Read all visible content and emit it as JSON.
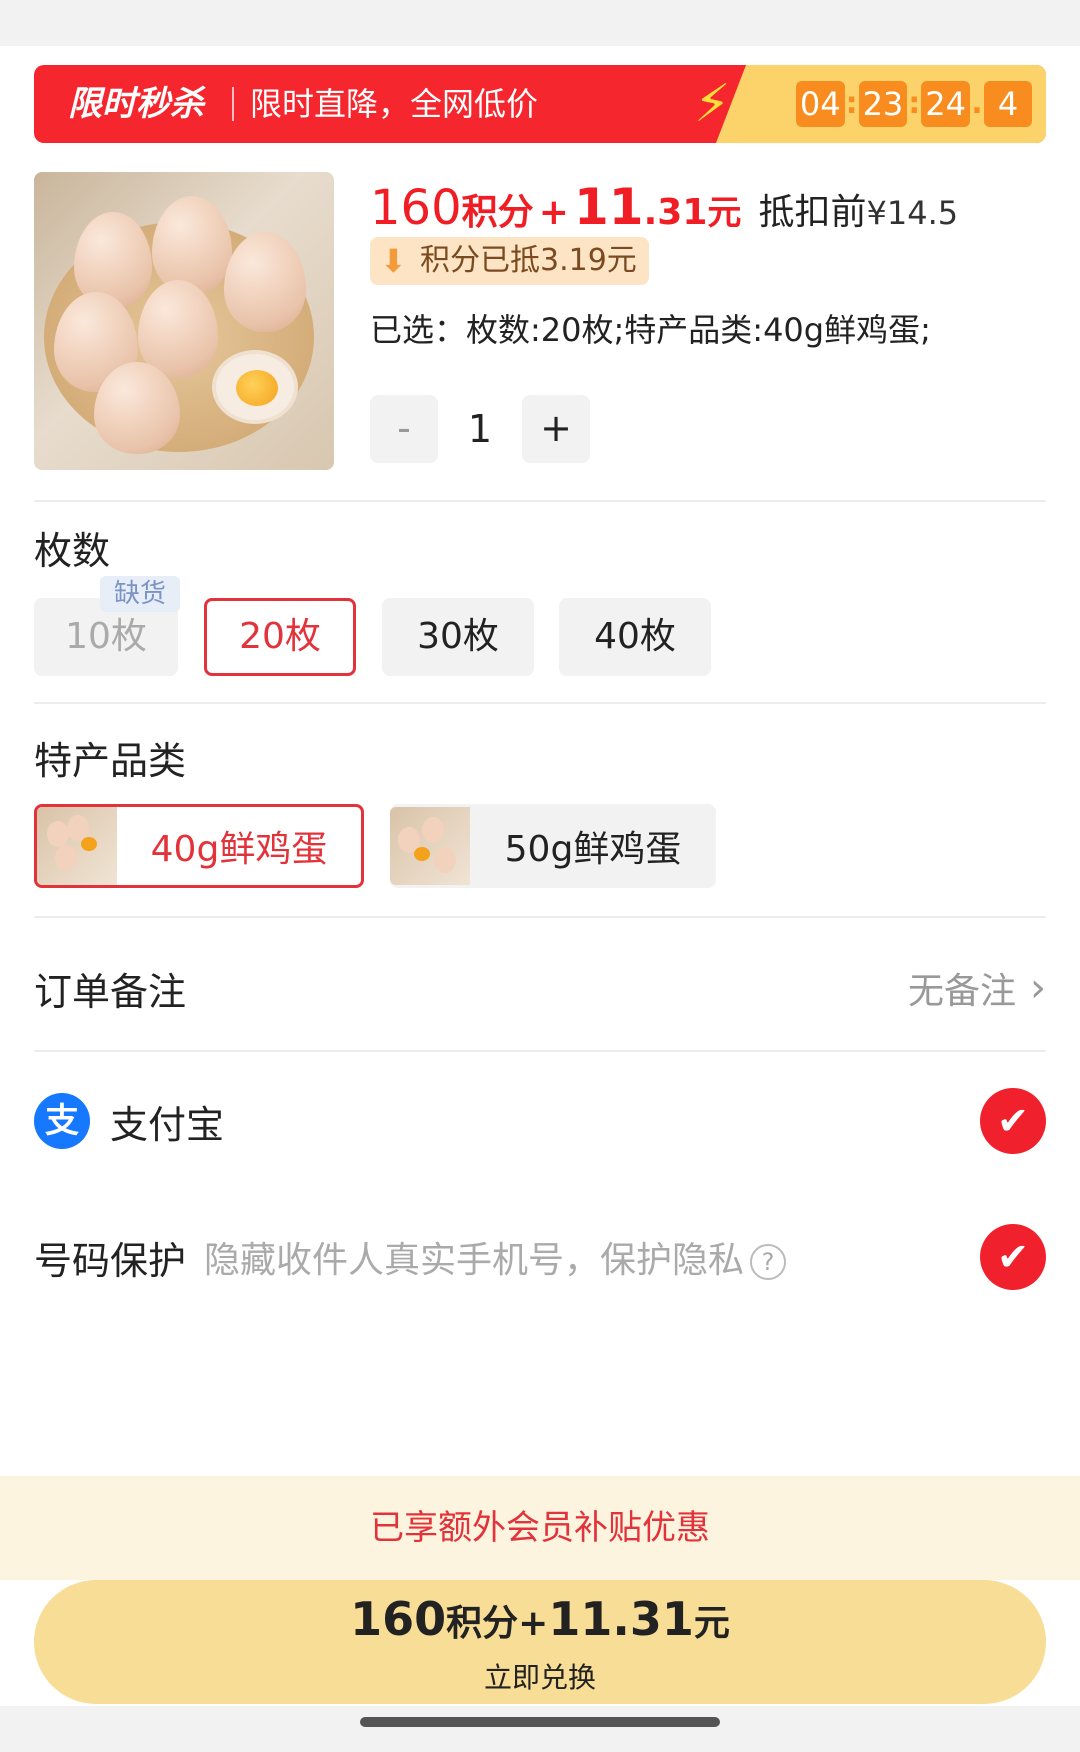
{
  "banner": {
    "tag": "限时秒杀",
    "slogan": "限时直降，全网低价",
    "timer": [
      "04",
      "23",
      "24",
      "4"
    ],
    "colors": {
      "bg": "#f5262d",
      "timer": "#f98c1e"
    }
  },
  "product": {
    "image_icon": "eggs-photo",
    "points": "160",
    "points_label": "积分",
    "plus": "+",
    "price_int": "11",
    "price_dec": ".31",
    "price_unit": "元",
    "before_label": "抵扣前",
    "original_price": "¥14.5",
    "deduct_text": "积分已抵3.19元",
    "selected_text": "已选：枚数:20枚;特产品类:40g鲜鸡蛋;",
    "quantity": "1",
    "minus_label": "-",
    "plus_label": "+"
  },
  "count": {
    "title": "枚数",
    "out_of_stock": "缺货",
    "options": [
      "10枚",
      "20枚",
      "30枚",
      "40枚"
    ],
    "selected": "20枚"
  },
  "variety": {
    "title": "特产品类",
    "options": [
      "40g鲜鸡蛋",
      "50g鲜鸡蛋"
    ],
    "selected": "40g鲜鸡蛋"
  },
  "remark": {
    "title": "订单备注",
    "value": "无备注"
  },
  "payment": {
    "method": "支付宝",
    "icon_glyph": "支",
    "checked": true
  },
  "privacy": {
    "title": "号码保护",
    "hint": "隐藏收件人真实手机号，保护隐私",
    "checked": true
  },
  "member_bar": "已享额外会员补贴优惠",
  "cta": {
    "points": "160",
    "points_label": "积分",
    "plus": "+",
    "price": "11.31",
    "unit": "元",
    "action": "立即兑换"
  }
}
